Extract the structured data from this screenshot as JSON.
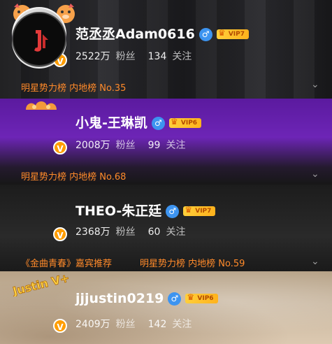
{
  "profiles": [
    {
      "name": "范丞丞Adam0616",
      "gender_icon": "male-icon",
      "gender_symbol": "♂",
      "vip": "VIP7",
      "fans_count": "2522万",
      "fans_label": "粉丝",
      "follow_count": "134",
      "follow_label": "关注",
      "rank_text": "明星势力榜 内地榜 No.35",
      "verified_mark": "V"
    },
    {
      "name": "小鬼-王琳凯",
      "gender_icon": "male-icon",
      "gender_symbol": "♂",
      "vip": "VIP6",
      "fans_count": "2008万",
      "fans_label": "粉丝",
      "follow_count": "99",
      "follow_label": "关注",
      "rank_text": "明星势力榜 内地榜 No.68",
      "verified_mark": "V"
    },
    {
      "name": "THEO-朱正廷",
      "gender_icon": "male-icon",
      "gender_symbol": "♂",
      "vip": "VIP7",
      "fans_count": "2368万",
      "fans_label": "粉丝",
      "follow_count": "60",
      "follow_label": "关注",
      "tag_text": "《金曲青春》嘉宾推荐",
      "rank_text": "明星势力榜 内地榜 No.59",
      "verified_mark": "V"
    },
    {
      "name": "jjjustin0219",
      "gender_icon": "male-icon",
      "gender_symbol": "♂",
      "vip": "VIP6",
      "fans_count": "2409万",
      "fans_label": "粉丝",
      "follow_count": "142",
      "follow_label": "关注",
      "verified_mark": "V",
      "avatar_deco_text": "Justin V+"
    }
  ],
  "icons": {
    "chevron": "chevron-down-icon",
    "crown": "crown-icon",
    "crown_symbol": "♛",
    "chevron_symbol": "⌄"
  },
  "colors": {
    "accent_orange": "#ff8a2a",
    "gender_blue": "#3d94f0",
    "vip_gold": "#ffc22e",
    "purple_bg": "#6d25b6"
  }
}
